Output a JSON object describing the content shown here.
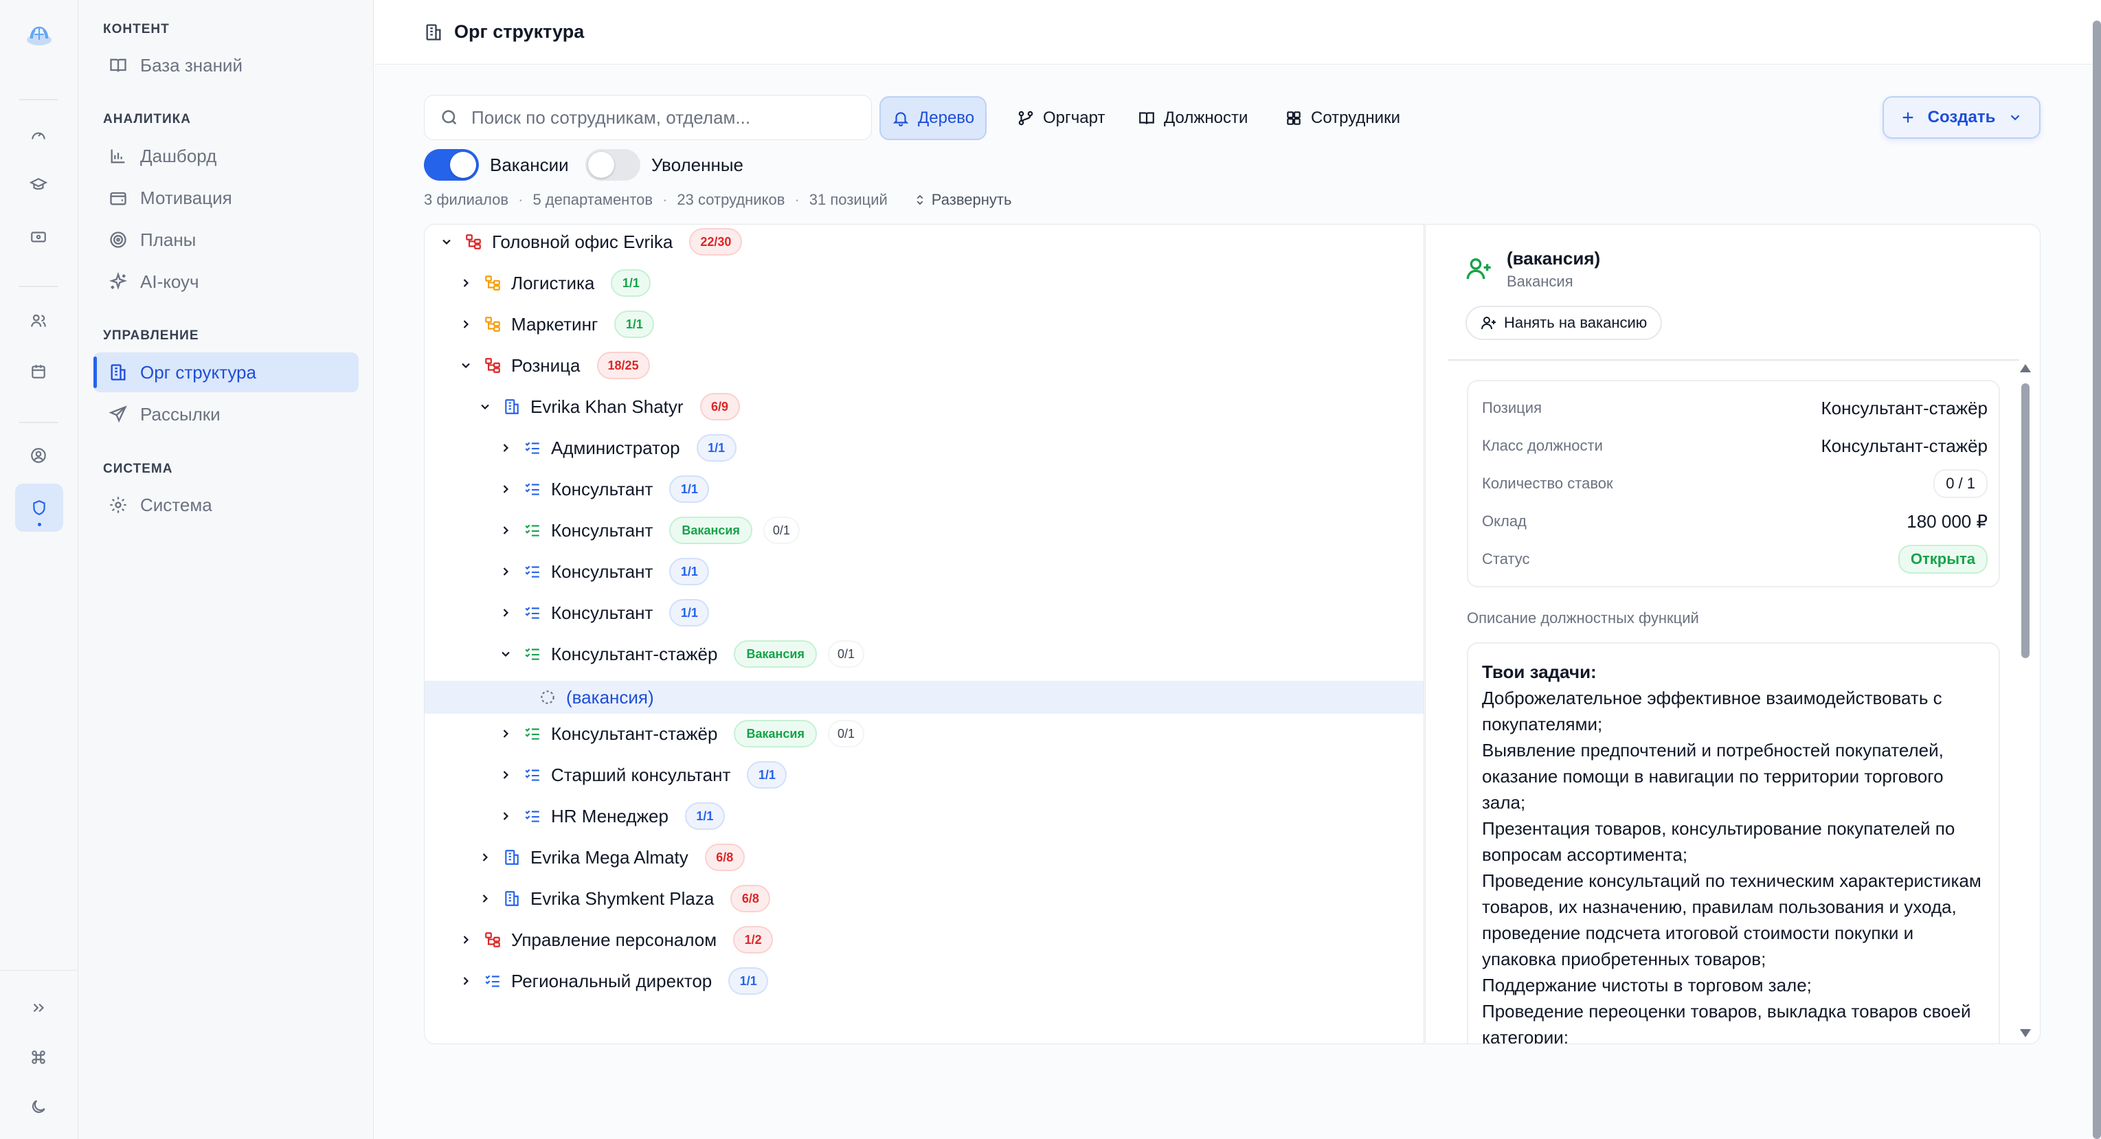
{
  "nav": {
    "sections": {
      "content": "КОНТЕНТ",
      "analytics": "АНАЛИТИКА",
      "management": "УПРАВЛЕНИЕ",
      "system": "СИСТЕМА"
    },
    "items": {
      "knowledge": "База знаний",
      "dashboard": "Дашборд",
      "motivation": "Мотивация",
      "plans": "Планы",
      "ai_coach": "AI-коуч",
      "org": "Орг структура",
      "mailings": "Рассылки",
      "system": "Система"
    }
  },
  "header": {
    "title": "Орг структура"
  },
  "toolbar": {
    "search_placeholder": "Поиск по сотрудникам, отделам...",
    "tabs": {
      "tree": "Дерево",
      "orgchart": "Оргчарт",
      "positions": "Должности",
      "employees": "Сотрудники"
    },
    "create_label": "Создать"
  },
  "toggles": {
    "vacancies": {
      "label": "Вакансии",
      "on": true
    },
    "dismissed": {
      "label": "Уволенные",
      "on": false
    }
  },
  "stats": {
    "branches": "3 филиалов",
    "departments": "5 департаментов",
    "employees": "23 сотрудников",
    "positions": "31 позиций",
    "expand": "Развернуть"
  },
  "tree": {
    "r0": {
      "label": "Головной офис Evrika",
      "badge": "22/30"
    },
    "r1": {
      "label": "Логистика",
      "badge": "1/1"
    },
    "r2": {
      "label": "Маркетинг",
      "badge": "1/1"
    },
    "r3": {
      "label": "Розница",
      "badge": "18/25"
    },
    "r4": {
      "label": "Evrika Khan Shatyr",
      "badge": "6/9"
    },
    "r5": {
      "label": "Администратор",
      "badge": "1/1"
    },
    "r6": {
      "label": "Консультант",
      "badge": "1/1"
    },
    "r7": {
      "label": "Консультант",
      "vacancy": "Вакансия",
      "ratio": "0/1"
    },
    "r8": {
      "label": "Консультант",
      "badge": "1/1"
    },
    "r9": {
      "label": "Консультант",
      "badge": "1/1"
    },
    "r10": {
      "label": "Консультант-стажёр",
      "vacancy": "Вакансия",
      "ratio": "0/1"
    },
    "r11": {
      "label": "(вакансия)"
    },
    "r12": {
      "label": "Консультант-стажёр",
      "vacancy": "Вакансия",
      "ratio": "0/1"
    },
    "r13": {
      "label": "Старший консультант",
      "badge": "1/1"
    },
    "r14": {
      "label": "HR Менеджер",
      "badge": "1/1"
    },
    "r15": {
      "label": "Evrika Mega Almaty",
      "badge": "6/8"
    },
    "r16": {
      "label": "Evrika Shymkent Plaza",
      "badge": "6/8"
    },
    "r17": {
      "label": "Управление персоналом",
      "badge": "1/2"
    },
    "r18": {
      "label": "Региональный директор",
      "badge": "1/1"
    }
  },
  "detail": {
    "title": "(вакансия)",
    "subtitle": "Вакансия",
    "hire_label": "Нанять на вакансию",
    "props": {
      "position": {
        "key": "Позиция",
        "value": "Консультант-стажёр"
      },
      "class": {
        "key": "Класс должности",
        "value": "Консультант-стажёр"
      },
      "rates": {
        "key": "Количество ставок",
        "value": "0 / 1"
      },
      "salary": {
        "key": "Оклад",
        "value": "180 000 ₽"
      },
      "status": {
        "key": "Статус",
        "value": "Открыта"
      }
    },
    "desc_label": "Описание должностных функций",
    "desc": {
      "title": "Твои задачи:",
      "l1": "Доброжелательное эффективное взаимодействовать с покупателями;",
      "l2": "Выявление предпочтений и потребностей покупателей, оказание помощи в навигации по территории торгового зала;",
      "l3": "Презентация товаров, консультирование покупателей по вопросам ассортимента;",
      "l4": "Проведение консультаций по техническим характеристикам товаров, их назначению, правилам пользования и ухода, проведение подсчета итоговой стоимости покупки и упаковка приобретенных товаров;",
      "l5": "Поддержание чистоты в торговом зале;",
      "l6": "Проведение переоценки товаров, выкладка товаров своей категории;"
    }
  },
  "colors": {
    "accent": "#2563eb",
    "danger": "#dc2626",
    "success": "#16a34a",
    "branch_icon": "#dc2626",
    "dept_icon": "#f59e0b",
    "store_icon": "#2563eb"
  }
}
